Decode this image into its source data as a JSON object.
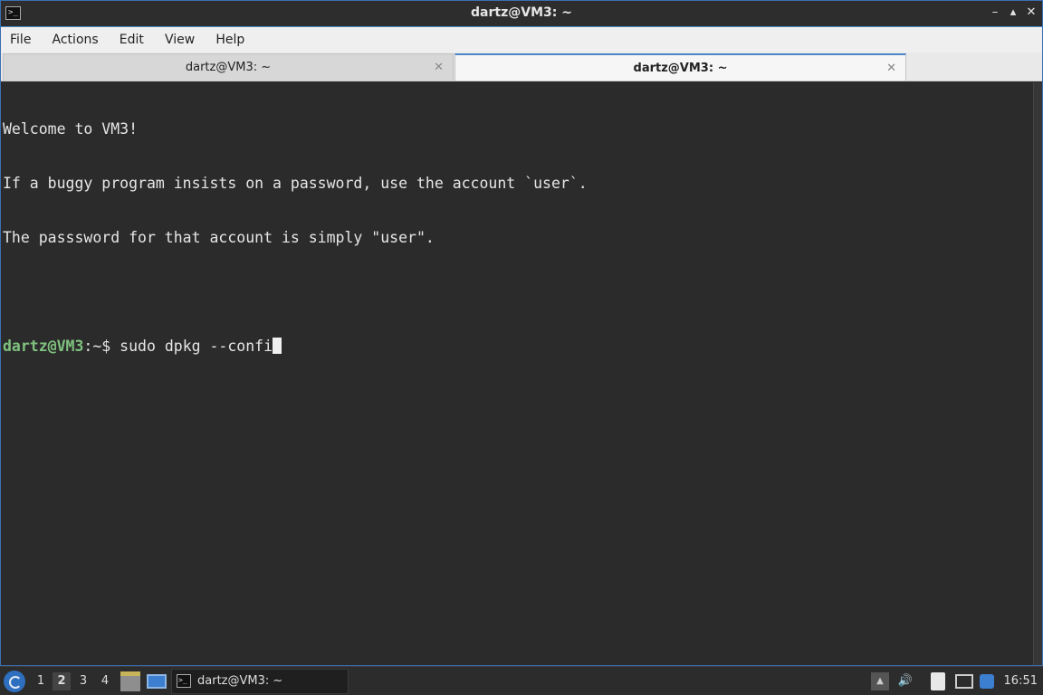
{
  "window": {
    "title": "dartz@VM3: ~",
    "app_icon": ">_",
    "minimize": "–",
    "maximize": "▴",
    "close": "✕"
  },
  "menu": [
    "File",
    "Actions",
    "Edit",
    "View",
    "Help"
  ],
  "tabs": [
    {
      "label": "dartz@VM3: ~",
      "active": false,
      "close": "✕"
    },
    {
      "label": "dartz@VM3: ~",
      "active": true,
      "close": "✕"
    }
  ],
  "terminal": {
    "lines": [
      "Welcome to VM3!",
      "If a buggy program insists on a password, use the account `user`.",
      "The passsword for that account is simply \"user\".",
      ""
    ],
    "prompt_user": "dartz@VM3",
    "prompt_path": ":~$ ",
    "command": "sudo dpkg --confi"
  },
  "taskbar": {
    "desktops": [
      "1",
      "2",
      "3",
      "4"
    ],
    "active_desktop": "2",
    "task_label": "dartz@VM3: ~",
    "task_icon": ">_",
    "tray_up": "▲",
    "volume": "🔊",
    "clock": "16:51"
  },
  "colors": {
    "accent": "#4a86c8",
    "terminal_bg": "#2b2b2b",
    "prompt_user": "#7fc27f"
  }
}
